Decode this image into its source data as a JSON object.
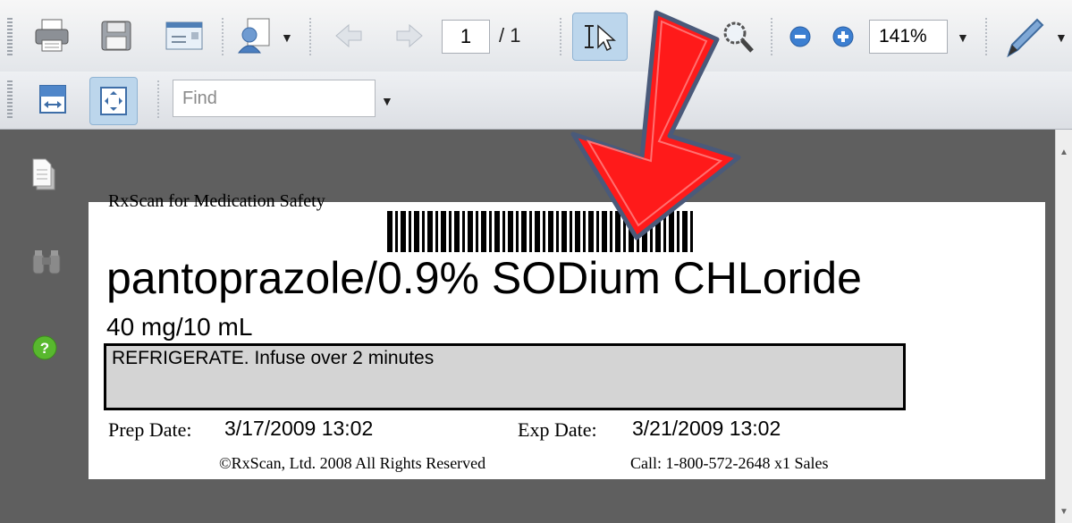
{
  "toolbar": {
    "page_current": "1",
    "page_total": "/ 1",
    "zoom": "141%"
  },
  "toolbar2": {
    "find_placeholder": "Find"
  },
  "label": {
    "header": "RxScan for Medication Safety",
    "drug": "pantoprazole/0.9% SODium CHLoride",
    "dose": "40 mg/10 mL",
    "instructions": "REFRIGERATE. Infuse over 2 minutes",
    "prep_label": "Prep Date:",
    "prep_value": "3/17/2009 13:02",
    "exp_label": "Exp Date:",
    "exp_value": "3/21/2009 13:02",
    "copyright": "©RxScan, Ltd. 2008 All Rights Reserved",
    "call": "Call: 1-800-572-2648 x1 Sales"
  },
  "colors": {
    "arrow_fill": "#ff0000",
    "arrow_outline": "#4a5a7a",
    "viewer_background": "#5f5f5f",
    "instruction_box": "#d4d4d4"
  }
}
